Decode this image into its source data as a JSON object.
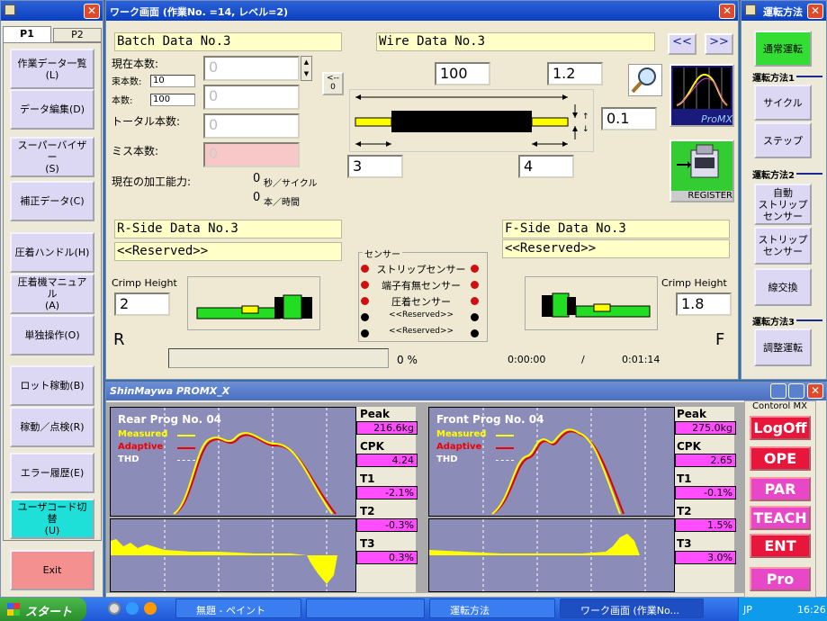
{
  "left": {
    "tabs": [
      "P1",
      "P2"
    ],
    "buttons": [
      "作業データ一覧(L)",
      "データ編集(D)",
      "スーパーバイザー\n(S)",
      "補正データ(C)",
      "圧着ハンドル(H)",
      "圧着機マニュアル\n(A)",
      "単独操作(O)",
      "ロット稼動(B)",
      "稼動／点検(R)",
      "エラー履歴(E)",
      "ユーザコード切替\n(U)"
    ],
    "exit": "Exit"
  },
  "work": {
    "title": "ワーク画面 (作業No. =14, レベル=2)",
    "batch": "Batch Data No.3",
    "wire": "Wire Data No.3",
    "current_label": "現在本数:",
    "bundle_label": "束本数:",
    "bundle_value": "10",
    "count_label": "本数:",
    "count_value": "100",
    "total_label": "トータル本数:",
    "miss_label": "ミス本数:",
    "current_value": "0",
    "middle_value": "0",
    "total_value": "0",
    "miss_value": "0",
    "reset_label": "<--\n0",
    "capacity_label": "現在の加工能力:",
    "capacity_1": "0",
    "capacity_1_unit": "秒／サイクル",
    "capacity_2": "0",
    "capacity_2_unit": "本／時間",
    "wire_length": "100",
    "wire_gauge": "1.2",
    "strip_gap": "0.1",
    "left_strip": "3",
    "right_strip": "4",
    "promx_label": "ProMX",
    "register_label": "REGISTER",
    "nav_prev": "<<",
    "nav_next": ">>",
    "r_side": "R-Side Data No.3",
    "r_reserved": "<<Reserved>>",
    "f_side": "F-Side Data No.3",
    "f_reserved": "<<Reserved>>",
    "crimp_label": "Crimp Height",
    "crimp_r": "2",
    "crimp_f": "1.8",
    "r_letter": "R",
    "f_letter": "F",
    "sensor_title": "センサー",
    "sensors": [
      "ストリップセンサー",
      "端子有無センサー",
      "圧着センサー",
      "<<Reserved>>",
      "<<Reserved>>"
    ],
    "sensor_states": [
      "red",
      "red",
      "red",
      "black",
      "black"
    ],
    "progress_percent": "0 %",
    "time_elapsed": "0:00:00",
    "time_sep": "/",
    "time_total": "0:01:14",
    "progress": 0
  },
  "right": {
    "title": "運転方法",
    "normal": "通常運転",
    "group1": "運転方法1",
    "cycle": "サイクル",
    "step": "ステップ",
    "group2": "運転方法2",
    "auto_strip": "自動\nストリップ\nセンサー",
    "strip_sensor": "ストリップ\nセンサー",
    "wire_change": "線交換",
    "group3": "運転方法3",
    "adjust": "調整運転"
  },
  "promx": {
    "title": "ShinMaywa PROMX_X",
    "rear": {
      "title": "Rear Prog No. 04",
      "measured": "Measured",
      "adaptive": "Adaptive",
      "thd": "THD",
      "peak_label": "Peak",
      "peak": "216.6kg",
      "cpk_label": "CPK",
      "cpk": "4.24",
      "t1_label": "T1",
      "t1": "-2.1%",
      "t2_label": "T2",
      "t2": "-0.3%",
      "t3_label": "T3",
      "t3": "0.3%"
    },
    "front": {
      "title": "Front Prog No. 04",
      "measured": "Measured",
      "adaptive": "Adaptive",
      "thd": "THD",
      "peak_label": "Peak",
      "peak": "275.0kg",
      "cpk_label": "CPK",
      "cpk": "2.65",
      "t1_label": "T1",
      "t1": "-0.1%",
      "t2_label": "T2",
      "t2": "1.5%",
      "t3_label": "T3",
      "t3": "3.0%"
    },
    "control_title": "Contorol MX",
    "controls": [
      "LogOff",
      "OPE",
      "PAR",
      "TEACH",
      "ENT"
    ],
    "pro": "Pro"
  },
  "taskbar": {
    "start": "スタート",
    "items": [
      "無題 - ペイント",
      "",
      "運転方法",
      "ワーク画面 (作業No..."
    ],
    "lang": "JP",
    "clock": "16:26"
  },
  "colors": {
    "title_blue": "#0a3fc0",
    "accent_green": "#33cc33",
    "measured": "#ffff00",
    "adaptive": "#e00000",
    "metric_bg": "#ff4dff",
    "control_red": "#e8163a"
  }
}
